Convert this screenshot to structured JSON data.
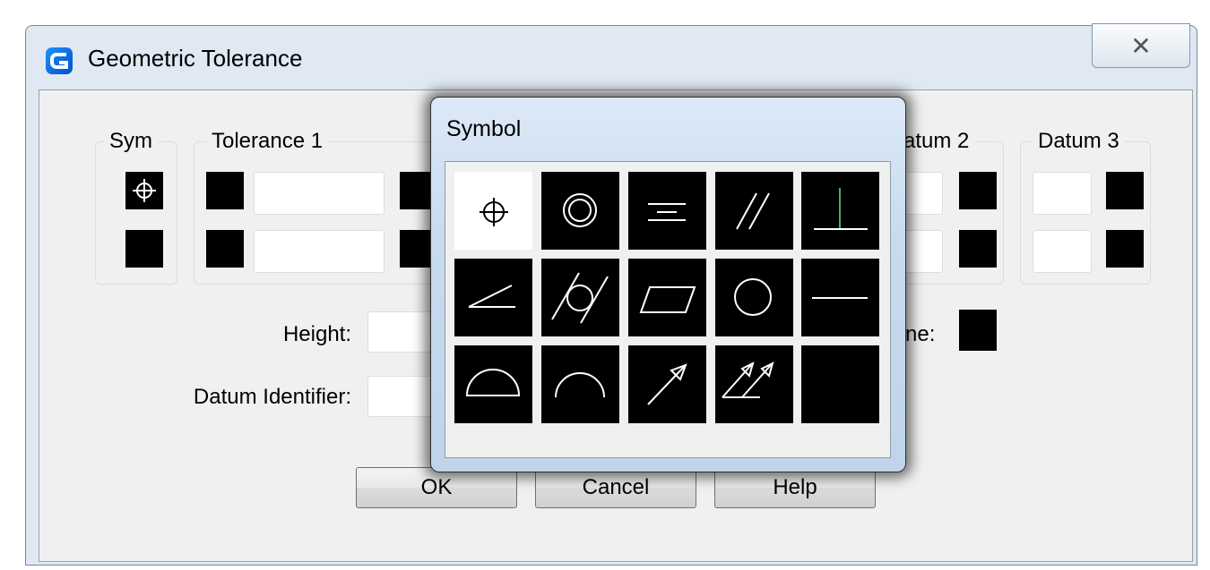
{
  "dialog": {
    "title": "Geometric Tolerance",
    "close_icon": "close-icon",
    "app_icon": "app-logo-icon"
  },
  "groups": {
    "sym": "Sym",
    "tolerance1": "Tolerance 1",
    "datum2": "atum 2",
    "datum3": "Datum 3"
  },
  "fields": {
    "height_label": "Height:",
    "datum_identifier_label": "Datum Identifier:",
    "projected_zone_label_fragment": "ne:"
  },
  "buttons": {
    "ok": "OK",
    "cancel": "Cancel",
    "help": "Help"
  },
  "symbol_popup": {
    "title": "Symbol",
    "selected_index": 0,
    "symbols": [
      "position-icon",
      "concentricity-icon",
      "symmetry-icon",
      "parallelism-icon",
      "perpendicularity-icon",
      "angularity-icon",
      "cylindricity-icon",
      "flatness-icon",
      "circularity-icon",
      "straightness-icon",
      "profile-of-surface-icon",
      "profile-of-line-icon",
      "circular-runout-icon",
      "total-runout-icon",
      "empty-symbol"
    ]
  }
}
